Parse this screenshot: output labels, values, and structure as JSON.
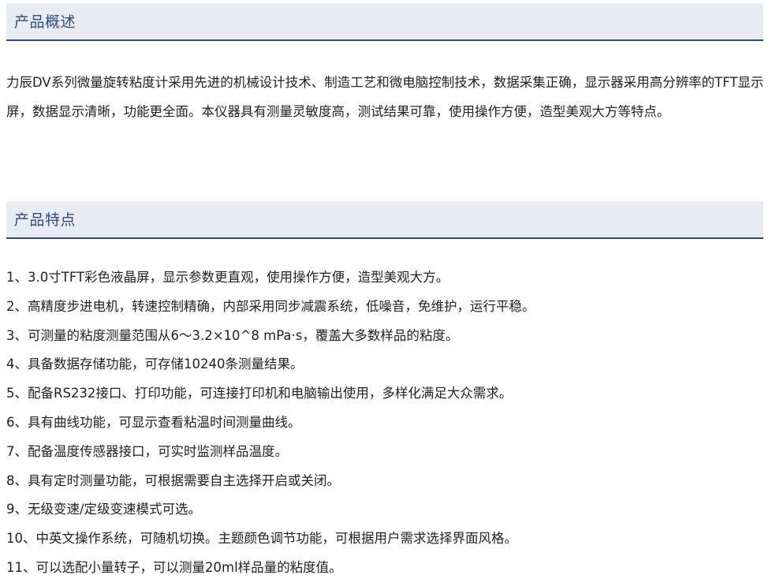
{
  "sections": {
    "overview": {
      "title": "产品概述",
      "text": "力辰DV系列微量旋转粘度计采用先进的机械设计技术、制造工艺和微电脑控制技术，数据采集正确，显示器采用高分辨率的TFT显示屏，数据显示清晰，功能更全面。本仪器具有测量灵敏度高，测试结果可靠，使用操作方便，造型美观大方等特点。"
    },
    "features": {
      "title": "产品特点",
      "items": [
        "1、3.0寸TFT彩色液晶屏，显示参数更直观，使用操作方便，造型美观大方。",
        "2、高精度步进电机，转速控制精确，内部采用同步减震系统，低噪音，免维护，运行平稳。",
        "3、可测量的粘度测量范围从6～3.2×10^8 mPa·s，覆盖大多数样品的粘度。",
        "4、具备数据存储功能，可存储10240条测量结果。",
        "5、配备RS232接口、打印功能，可连接打印机和电脑输出使用，多样化满足大众需求。",
        "6、具有曲线功能，可显示查看粘温时间测量曲线。",
        "7、配备温度传感器接口，可实时监测样品温度。",
        "8、具有定时测量功能，可根据需要自主选择开启或关闭。",
        "9、无级变速/定级变速模式可选。",
        "10、中英文操作系统，可随机切换。主题颜色调节功能，可根据用户需求选择界面风格。",
        "11、可以选配小量转子，可以测量20ml样品量的粘度值。"
      ]
    }
  },
  "colors": {
    "header_bg": "#e9ecf3",
    "header_text": "#2f4a7d",
    "header_rule": "#2f4a7d",
    "body_text": "#222222"
  }
}
